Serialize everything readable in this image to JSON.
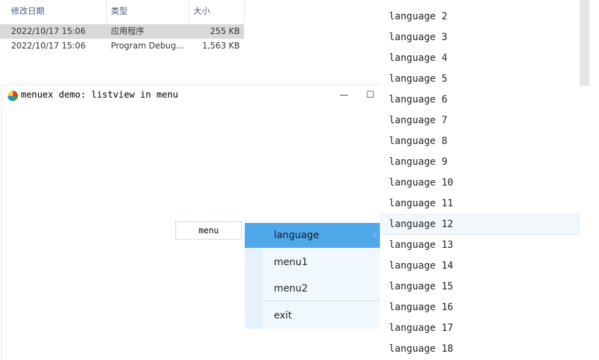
{
  "explorer": {
    "columns": [
      "修改日期",
      "类型",
      "大小"
    ],
    "rows": [
      {
        "date": "2022/10/17 15:06",
        "type": "应用程序",
        "size": "255 KB"
      },
      {
        "date": "2022/10/17 15:06",
        "type": "Program Debug...",
        "size": "1,563 KB"
      }
    ]
  },
  "window": {
    "title": "menuex demo: listview in menu",
    "minimize_glyph": "—",
    "maximize_glyph": "☐",
    "close_glyph": "✕"
  },
  "menu_button": {
    "label": "menu"
  },
  "popup": {
    "items": [
      {
        "label": "language"
      },
      {
        "label": "menu1"
      },
      {
        "label": "menu2"
      },
      {
        "label": "exit"
      }
    ]
  },
  "languages": [
    "language 2",
    "language 3",
    "language 4",
    "language 5",
    "language 6",
    "language 7",
    "language 8",
    "language 9",
    "language 10",
    "language 11",
    "language 12",
    "language 13",
    "language 14",
    "language 15",
    "language 16",
    "language 17",
    "language 18"
  ]
}
